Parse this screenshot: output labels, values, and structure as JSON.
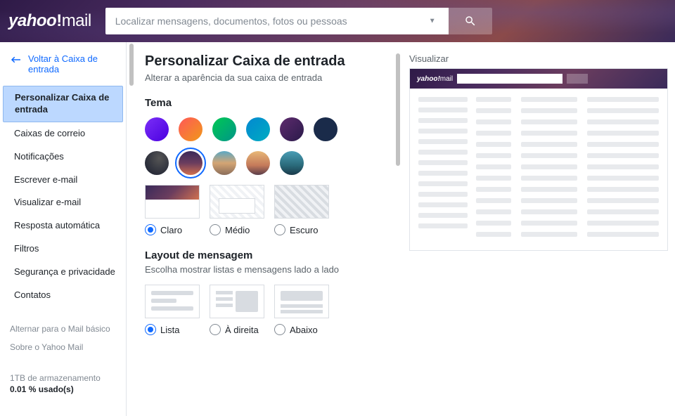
{
  "header": {
    "logo_core": "yahoo",
    "logo_bang": "!",
    "logo_suffix": "mail",
    "search_placeholder": "Localizar mensagens, documentos, fotos ou pessoas"
  },
  "sidebar": {
    "back_label": "Voltar à Caixa de entrada",
    "items": [
      "Personalizar Caixa de entrada",
      "Caixas de correio",
      "Notificações",
      "Escrever e-mail",
      "Visualizar e-mail",
      "Resposta automática",
      "Filtros",
      "Segurança e privacidade",
      "Contatos"
    ],
    "footer": [
      "Alternar para o Mail básico",
      "Sobre o Yahoo Mail"
    ],
    "storage_line1": "1TB de armazenamento",
    "storage_line2": "0.01 % usado(s)"
  },
  "settings": {
    "title": "Personalizar Caixa de entrada",
    "subtitle": "Alterar a aparência da sua caixa de entrada",
    "theme_heading": "Tema",
    "mode_options": [
      "Claro",
      "Médio",
      "Escuro"
    ],
    "layout_heading": "Layout de mensagem",
    "layout_sub": "Escolha mostrar listas e mensagens lado a lado",
    "layout_options": [
      "Lista",
      "À direita",
      "Abaixo"
    ]
  },
  "preview": {
    "title": "Visualizar",
    "logo_core": "yahoo!",
    "logo_suffix": "mail"
  }
}
